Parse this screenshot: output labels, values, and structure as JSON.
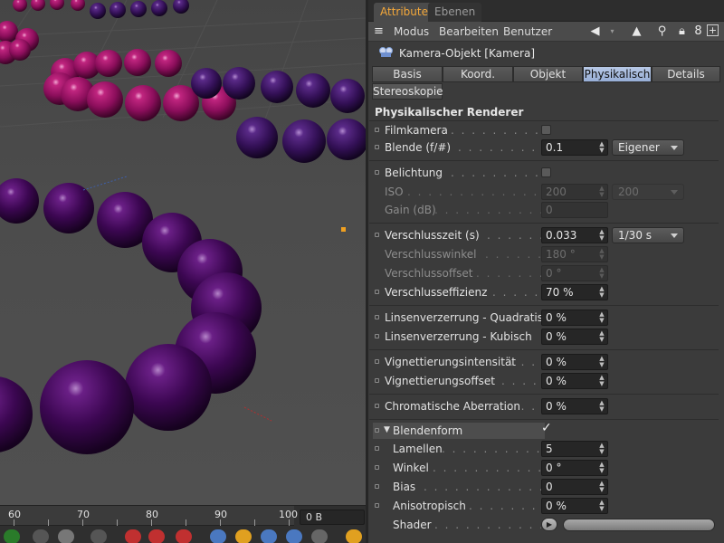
{
  "panel": {
    "tabs": [
      "Attribute",
      "Ebenen"
    ],
    "menu": [
      "Modus",
      "Bearbeiten",
      "Benutzer"
    ],
    "object_title": "Kamera-Objekt [Kamera]",
    "tabs_row1": [
      "Basis",
      "Koord.",
      "Objekt",
      "Physikalisch",
      "Details"
    ],
    "tabs_row2": [
      "Stereoskopie"
    ],
    "active_tab": "Physikalisch",
    "section_title": "Physikalischer Renderer"
  },
  "rows": {
    "filmkamera": "Filmkamera",
    "blende": {
      "label": "Blende (f/#)",
      "value": "0.1",
      "dropdown": "Eigener"
    },
    "belichtung": "Belichtung",
    "iso": {
      "label": "ISO",
      "value": "200",
      "dropdown": "200"
    },
    "gain": {
      "label": "Gain (dB)",
      "value": "0"
    },
    "verschlusszeit": {
      "label": "Verschlusszeit (s)",
      "value": "0.033",
      "dropdown": "1/30 s"
    },
    "verschlusswinkel": {
      "label": "Verschlusswinkel",
      "value": "180 °"
    },
    "verschlussoffset": {
      "label": "Verschlussoffset",
      "value": "0 °"
    },
    "verschlusseffizienz": {
      "label": "Verschlusseffizienz",
      "value": "70 %"
    },
    "linsen_quad": {
      "label": "Linsenverzerrung - Quadratisch",
      "value": "0 %"
    },
    "linsen_kub": {
      "label": "Linsenverzerrung - Kubisch",
      "value": "0 %"
    },
    "vig_int": {
      "label": "Vignettierungsintensität",
      "value": "0 %"
    },
    "vig_off": {
      "label": "Vignettierungsoffset",
      "value": "0 %"
    },
    "chrom": {
      "label": "Chromatische Aberration",
      "value": "0 %"
    },
    "blendenform": {
      "label": "Blendenform",
      "checked": true
    },
    "lamellen": {
      "label": "Lamellen",
      "value": "5"
    },
    "winkel": {
      "label": "Winkel",
      "value": "0 °"
    },
    "bias": {
      "label": "Bias",
      "value": "0"
    },
    "aniso": {
      "label": "Anisotropisch",
      "value": "0 %"
    },
    "shader": {
      "label": "Shader"
    }
  },
  "timeline": {
    "ticks": [
      "60",
      "70",
      "80",
      "90",
      "100"
    ],
    "frame_value": "0 B"
  },
  "colors": {
    "accent": "#f4a83a",
    "active_tab": "#a9bde0",
    "sphere_dark": "#4a0a62",
    "sphere_pink": "#a3136b"
  },
  "icons": [
    "camera-icon",
    "arrow-icon",
    "cursor-icon",
    "search-icon",
    "lock-icon",
    "hierarchy-icon",
    "add-icon"
  ]
}
